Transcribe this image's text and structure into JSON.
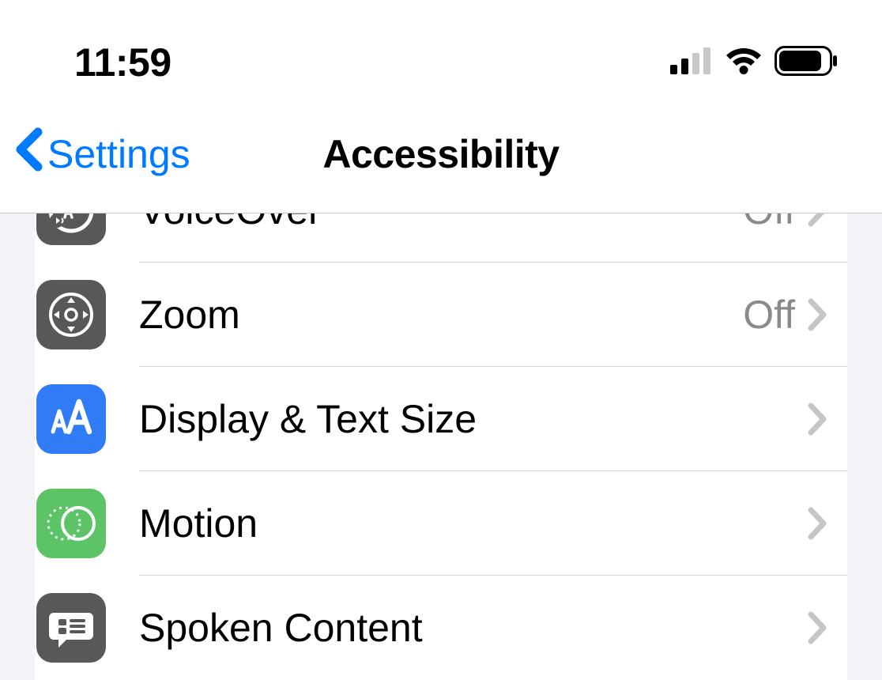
{
  "status": {
    "time": "11:59"
  },
  "nav": {
    "back_label": "Settings",
    "title": "Accessibility"
  },
  "rows": {
    "voiceover": {
      "label": "VoiceOver",
      "value": "Off"
    },
    "zoom": {
      "label": "Zoom",
      "value": "Off"
    },
    "display": {
      "label": "Display & Text Size"
    },
    "motion": {
      "label": "Motion"
    },
    "spoken": {
      "label": "Spoken Content"
    }
  }
}
